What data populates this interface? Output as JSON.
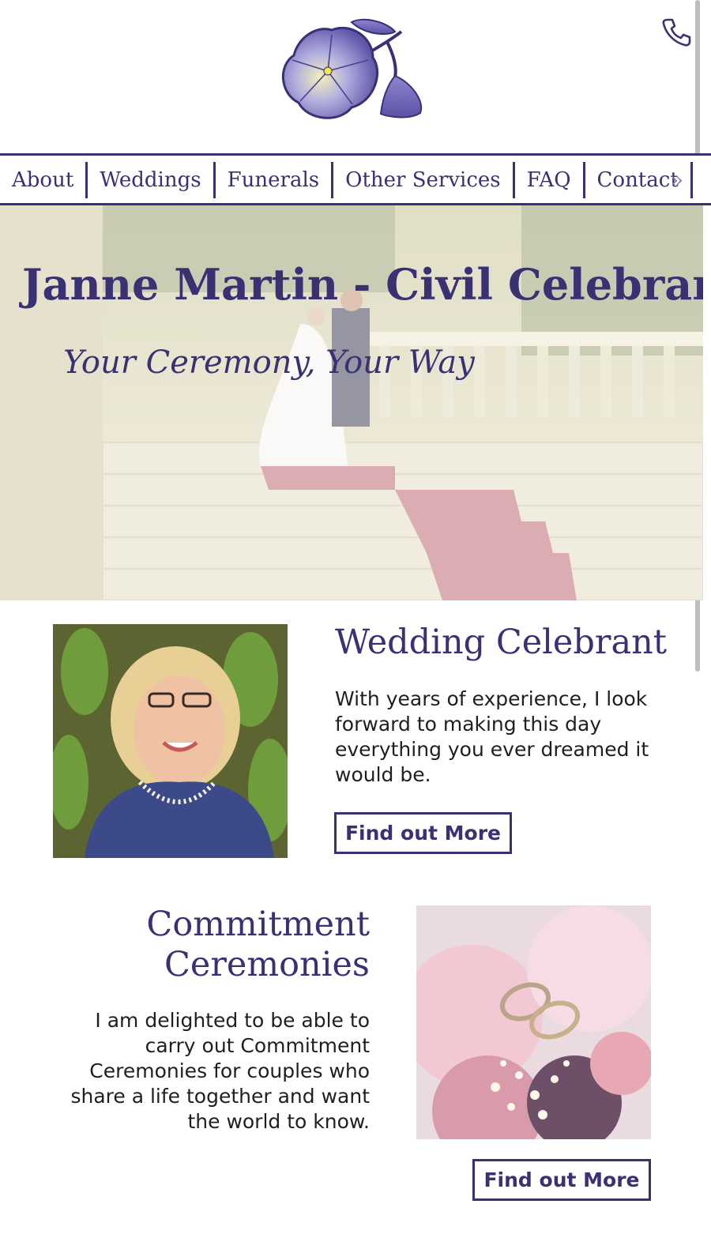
{
  "header": {
    "logo_icon": "flower-logo-icon",
    "phone_icon": "phone-icon"
  },
  "nav": {
    "items": [
      {
        "label": "About"
      },
      {
        "label": "Weddings"
      },
      {
        "label": "Funerals"
      },
      {
        "label": "Other Services"
      },
      {
        "label": "FAQ"
      },
      {
        "label": "Contact"
      }
    ],
    "more_label": "»"
  },
  "hero": {
    "title": "Janne Martin - Civil Celebrant",
    "tagline": "Your Ceremony, Your Way"
  },
  "wedding": {
    "title": "Wedding Celebrant",
    "text": "With years of experience, I look forward to making this day everything you ever dreamed it would be.",
    "button": "Find out More"
  },
  "commitment": {
    "title_line1": "Commitment",
    "title_line2": "Ceremonies",
    "text": "I am delighted to be able to carry out Commitment Ceremonies for couples who share a life together and want the world to know.",
    "button": "Find out More"
  },
  "colors": {
    "brand": "#3a3175",
    "text": "#1f1f1f",
    "background": "#ffffff"
  }
}
